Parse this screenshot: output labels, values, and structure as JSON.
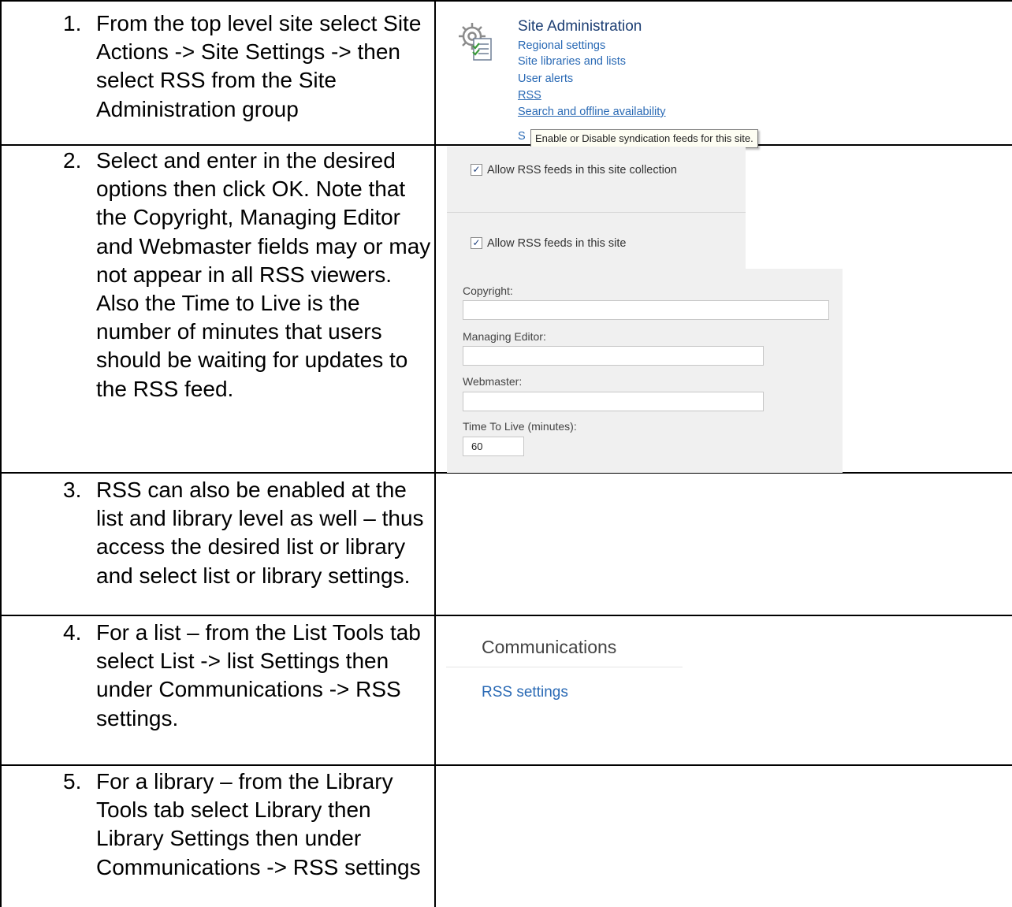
{
  "steps": [
    {
      "num": "1.",
      "text": "From the top level site select Site Actions -> Site Settings -> then select RSS from the Site Administration group"
    },
    {
      "num": "2.",
      "text": "Select and enter in the desired options then click OK. Note that the Copyright, Managing Editor and Webmaster fields may or may not appear in all RSS viewers. Also the Time to Live is the number of minutes that users should be waiting for updates to the RSS feed."
    },
    {
      "num": "3.",
      "text": "RSS can also be enabled at the list and library level as well – thus access the desired list or library and select list or library settings."
    },
    {
      "num": "4.",
      "text": "For a list – from the List Tools tab select List -> list Settings then under Communications -> RSS settings."
    },
    {
      "num": "5.",
      "text": "For a library – from the Library Tools tab select Library then Library Settings then under Communications -> RSS settings"
    }
  ],
  "site_admin": {
    "title": "Site Administration",
    "links": [
      "Regional settings",
      "Site libraries and lists",
      "User alerts",
      "RSS",
      "Search and offline availability"
    ],
    "cut_link": "S",
    "tooltip": "Enable or Disable syndication feeds for this site."
  },
  "rss_options": {
    "collection_label": "Allow RSS feeds in this site collection",
    "collection_checked": true,
    "site_label": "Allow RSS feeds in this site",
    "site_checked": true,
    "check_glyph": "✓",
    "copyright_label": "Copyright:",
    "copyright_value": "",
    "editor_label": "Managing Editor:",
    "editor_value": "",
    "webmaster_label": "Webmaster:",
    "webmaster_value": "",
    "ttl_label": "Time To Live (minutes):",
    "ttl_value": "60"
  },
  "communications": {
    "title": "Communications",
    "link": "RSS settings"
  }
}
